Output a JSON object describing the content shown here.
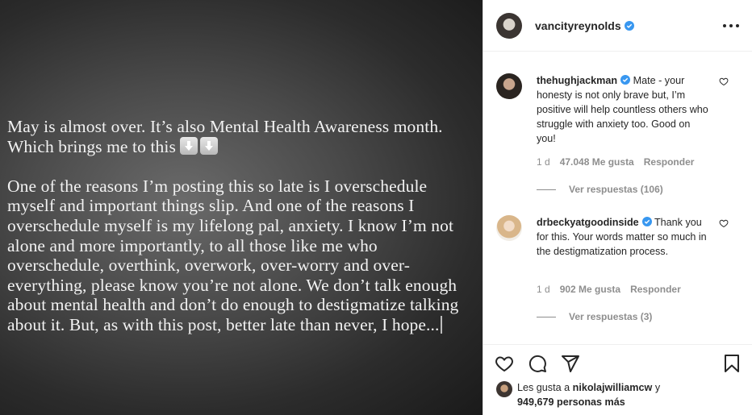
{
  "post": {
    "paragraph1_line1": "May is almost over. It’s also Mental Health Awareness month.",
    "paragraph1_line2": "Which brings me to this",
    "emoji": "⬇️⬇️",
    "paragraph2": "One of the reasons I’m posting this so late is I overschedule myself and important things slip. And one of the reasons I overschedule myself is my lifelong pal, anxiety. I know I’m not alone and more importantly, to all those like me who overschedule, overthink, overwork, over-worry and over-everything, please know you’re not alone. We don’t talk enough about mental health and don’t do enough to destigmatize talking about it. But, as with this post, better late than never, I hope...",
    "background_color": "#3a3a3a"
  },
  "header": {
    "username": "vancityreynolds",
    "verified_icon": "verified-badge-icon",
    "more_icon": "more-options-icon"
  },
  "comments": [
    {
      "username": "thehughjackman",
      "text": "Mate - your honesty is not only brave but, I’m positive will help countless others who struggle with anxiety too. Good on you!",
      "time": "1 d",
      "likes": "47.048 Me gusta",
      "reply_label": "Responder",
      "view_replies": "Ver respuestas (106)"
    },
    {
      "username": "drbeckyatgoodinside",
      "text": "Thank you for this. Your words matter so much in the destigmatization process.",
      "time": "1 d",
      "likes": "902 Me gusta",
      "reply_label": "Responder",
      "view_replies": "Ver respuestas (3)"
    }
  ],
  "actions": {
    "icons": [
      "heart-icon",
      "comment-icon",
      "share-icon",
      "bookmark-icon"
    ]
  },
  "likes_summary": {
    "prefix": "Les gusta a",
    "user": "nikolajwilliamcw",
    "conj": "y",
    "count": "949,679 personas más"
  },
  "colors": {
    "verified": "#3897f0",
    "text": "#262626",
    "muted": "#8e8e8e"
  }
}
